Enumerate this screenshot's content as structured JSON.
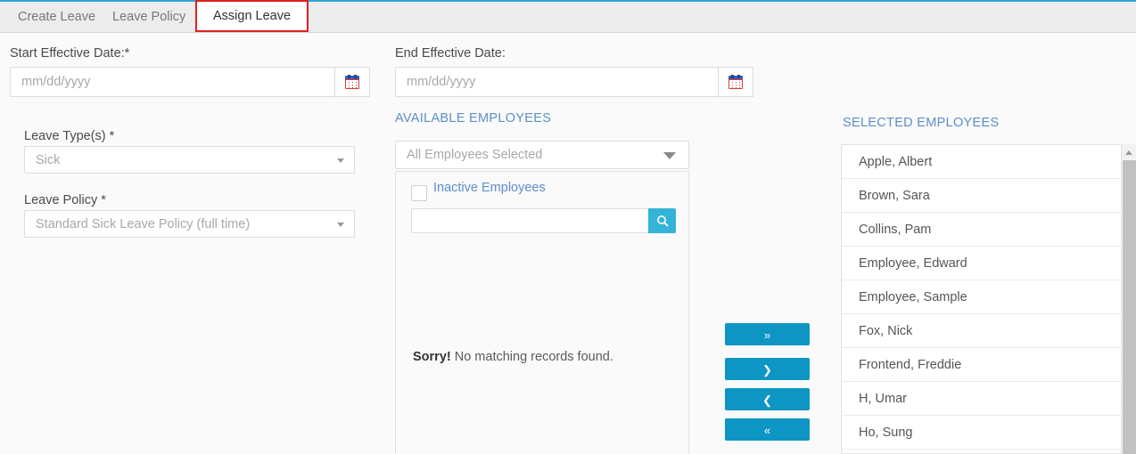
{
  "tabs": [
    {
      "id": "create-leave",
      "label": "Create Leave",
      "active": false
    },
    {
      "id": "leave-policy",
      "label": "Leave Policy",
      "active": false
    },
    {
      "id": "assign-leave",
      "label": "Assign Leave",
      "active": true
    }
  ],
  "form": {
    "start_date": {
      "label": "Start Effective Date:*",
      "placeholder": "mm/dd/yyyy",
      "value": "",
      "calendar_icon": "calendar-icon"
    },
    "end_date": {
      "label": "End Effective Date:",
      "placeholder": "mm/dd/yyyy",
      "value": "",
      "calendar_icon": "calendar-icon"
    },
    "leave_types": {
      "label": "Leave Type(s) *",
      "value": "Sick"
    },
    "leave_policy": {
      "label": "Leave Policy *",
      "value": "Standard Sick Leave Policy (full time)"
    }
  },
  "available": {
    "heading": "AVAILABLE EMPLOYEES",
    "filter_value": "All Employees Selected",
    "inactive_label": "Inactive Employees",
    "inactive_checked": false,
    "search_value": "",
    "search_placeholder": "",
    "search_icon": "search-icon",
    "empty_bold": "Sorry!",
    "empty_text": " No matching records found."
  },
  "transfer_buttons": [
    {
      "id": "move-all-right",
      "glyph": "»"
    },
    {
      "id": "move-right",
      "glyph": "❯"
    },
    {
      "id": "move-left",
      "glyph": "❮"
    },
    {
      "id": "move-all-left",
      "glyph": "«"
    }
  ],
  "selected": {
    "heading": "SELECTED EMPLOYEES",
    "employees": [
      "Apple, Albert",
      "Brown, Sara",
      "Collins, Pam",
      "Employee, Edward",
      "Employee, Sample",
      "Fox, Nick",
      "Frontend, Freddie",
      "H, Umar",
      "Ho, Sung"
    ]
  },
  "colors": {
    "accent_blue": "#29a8d3",
    "button_blue": "#0d96c4",
    "search_blue": "#35b3d7",
    "link_blue": "#5b8fc9",
    "highlight_red": "#e02020",
    "page_bg": "#fafafa",
    "tabbar_bg": "#ececec"
  }
}
